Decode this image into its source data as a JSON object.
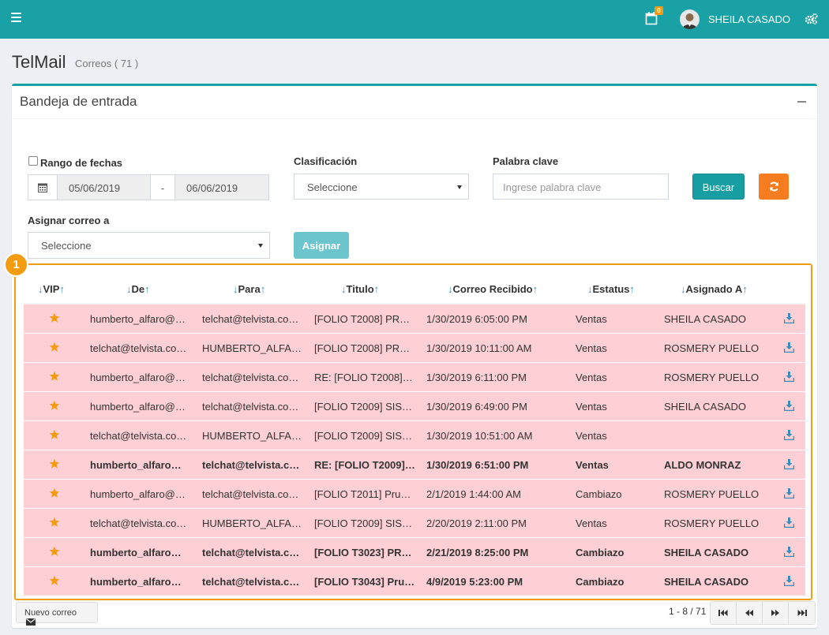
{
  "topbar": {
    "user_name": "SHEILA CASADO",
    "calendar_badge": "0"
  },
  "page": {
    "title": "TelMail",
    "subtitle": "Correos ( 71 )"
  },
  "box": {
    "title": "Bandeja de entrada"
  },
  "filters": {
    "date_range_label": "Rango de fechas",
    "date_from": "05/06/2019",
    "date_separator": "-",
    "date_to": "06/06/2019",
    "classification_label": "Clasificación",
    "classification_value": "Seleccione",
    "keyword_label": "Palabra clave",
    "keyword_placeholder": "Ingrese palabra clave",
    "search_button": "Buscar",
    "assign_label": "Asignar correo a",
    "assign_value": "Seleccione",
    "assign_button": "Asignar"
  },
  "annotation_badge": "1",
  "table": {
    "headers": [
      "VIP",
      "De",
      "Para",
      "Titulo",
      "Correo Recibido",
      "Estatus",
      "Asignado A"
    ],
    "rows": [
      {
        "bold": false,
        "from": "humberto_alfaro@…",
        "to": "telchat@telvista.co…",
        "title": "[FOLIO T2008] PR…",
        "received": "1/30/2019 6:05:00 PM",
        "status": "Ventas",
        "assigned": "SHEILA CASADO"
      },
      {
        "bold": false,
        "from": "telchat@telvista.co…",
        "to": "HUMBERTO_ALFAR…",
        "title": "[FOLIO T2008] PR…",
        "received": "1/30/2019 10:11:00 AM",
        "status": "Ventas",
        "assigned": "ROSMERY PUELLO"
      },
      {
        "bold": false,
        "from": "humberto_alfaro@…",
        "to": "telchat@telvista.co…",
        "title": "RE: [FOLIO T2008]…",
        "received": "1/30/2019 6:11:00 PM",
        "status": "Ventas",
        "assigned": "ROSMERY PUELLO"
      },
      {
        "bold": false,
        "from": "humberto_alfaro@…",
        "to": "telchat@telvista.co…",
        "title": "[FOLIO T2009] SIS…",
        "received": "1/30/2019 6:49:00 PM",
        "status": "Ventas",
        "assigned": "SHEILA CASADO"
      },
      {
        "bold": false,
        "from": "telchat@telvista.co…",
        "to": "HUMBERTO_ALFAR…",
        "title": "[FOLIO T2009] SIS…",
        "received": "1/30/2019 10:51:00 AM",
        "status": "Ventas",
        "assigned": ""
      },
      {
        "bold": true,
        "from": "humberto_alfaro…",
        "to": "telchat@telvista.c…",
        "title": "RE: [FOLIO T2009]…",
        "received": "1/30/2019 6:51:00 PM",
        "status": "Ventas",
        "assigned": "ALDO MONRAZ"
      },
      {
        "bold": false,
        "from": "humberto_alfaro@…",
        "to": "telchat@telvista.co…",
        "title": "[FOLIO T2011] Pru…",
        "received": "2/1/2019 1:44:00 AM",
        "status": "Cambiazo",
        "assigned": "ROSMERY PUELLO"
      },
      {
        "bold": false,
        "from": "telchat@telvista.co…",
        "to": "HUMBERTO_ALFAR…",
        "title": "[FOLIO T2009] SIS…",
        "received": "2/20/2019 2:11:00 PM",
        "status": "Ventas",
        "assigned": "ROSMERY PUELLO"
      },
      {
        "bold": true,
        "from": "humberto_alfaro…",
        "to": "telchat@telvista.c…",
        "title": "[FOLIO T3023] PR…",
        "received": "2/21/2019 8:25:00 PM",
        "status": "Cambiazo",
        "assigned": "SHEILA CASADO"
      },
      {
        "bold": true,
        "from": "humberto_alfaro…",
        "to": "telchat@telvista.c…",
        "title": "[FOLIO T3043] Pru…",
        "received": "4/9/2019 5:23:00 PM",
        "status": "Cambiazo",
        "assigned": "SHEILA CASADO"
      }
    ]
  },
  "footer": {
    "new_mail_button": "Nuevo correo",
    "pager_info": "1 - 8 / 71"
  },
  "colors": {
    "topbar": "#1aa1a5",
    "row_bg": "#fecfd4",
    "highlight": "#f39c12",
    "star": "#f39c12",
    "refresh": "#f57c1f"
  }
}
